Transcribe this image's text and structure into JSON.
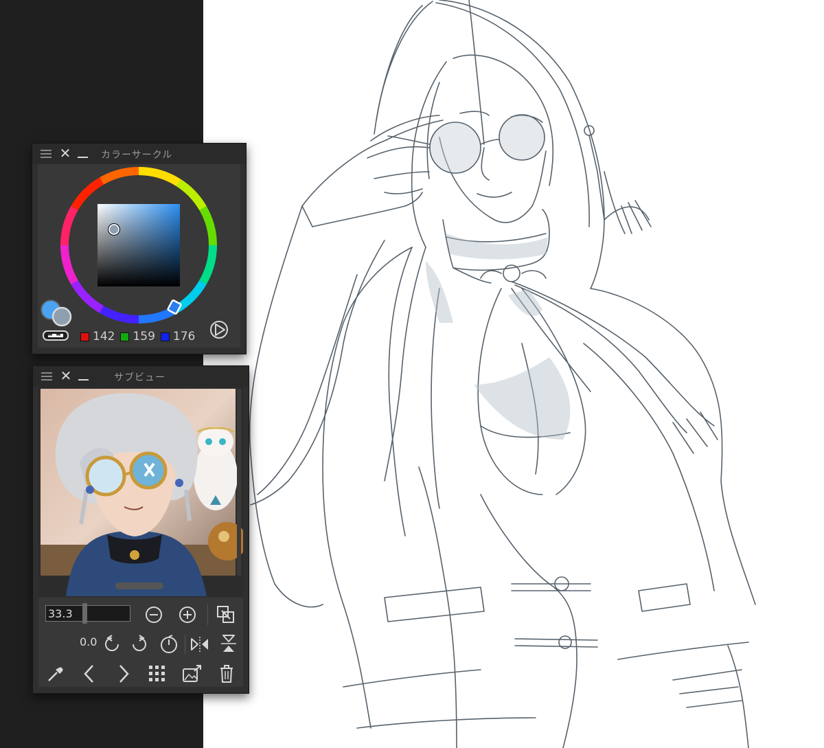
{
  "colors": {
    "canvas_bg": "#ffffff",
    "app_bg": "#1f1f1f",
    "panel_bg": "#2f2f2f",
    "sketch_line": "#4f5a64",
    "main_color": "#4aa3ef",
    "sub_color": "#8e9fb0"
  },
  "color_circle_panel": {
    "title": "カラーサークル",
    "rgb": {
      "r": "142",
      "g": "159",
      "b": "176"
    },
    "icons": [
      "menu-icon",
      "close-icon",
      "minimize-icon",
      "play-circle-icon",
      "transparent-color-icon"
    ]
  },
  "subview_panel": {
    "title": "サブビュー",
    "zoom": "33.3",
    "rotation": "0.0",
    "icons": [
      "zoom-out-icon",
      "zoom-in-icon",
      "fit-window-icon",
      "rotate-left-icon",
      "rotate-right-icon",
      "reset-rotation-icon",
      "flip-horizontal-icon",
      "flip-vertical-icon",
      "eyedropper-icon",
      "previous-icon",
      "next-icon",
      "grid-icon",
      "import-image-icon",
      "trash-icon"
    ]
  }
}
